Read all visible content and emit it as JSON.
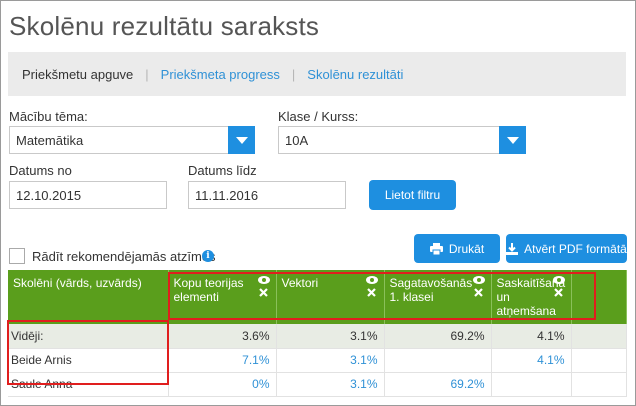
{
  "page": {
    "title": "Skolēnu rezultātu saraksts"
  },
  "subnav": {
    "items": [
      {
        "label": "Priekšmetu apguve",
        "active": true
      },
      {
        "label": "Priekšmeta progress",
        "active": false
      },
      {
        "label": "Skolēnu rezultāti",
        "active": false
      }
    ],
    "separator": "|"
  },
  "filters": {
    "subject_label": "Mācību tēma:",
    "subject_value": "Matemātika",
    "class_label": "Klase / Kurss:",
    "class_value": "10A",
    "date_from_label": "Datums no",
    "date_from_value": "12.10.2015",
    "date_to_label": "Datums līdz",
    "date_to_value": "11.11.2016",
    "apply_label": "Lietot filtru"
  },
  "options": {
    "show_recommended_label": "Rādīt rekomendējamās atzīmes",
    "info_icon": "i",
    "print_label": "Drukāt",
    "pdf_label": "Atvērt PDF formātā"
  },
  "table": {
    "headers": [
      "Skolēni (vārds, uzvārds)",
      "Kopu teorijas elementi",
      "Vektori",
      "Sagatavošanās 1. klasei",
      "Saskaitīšana un atņemšana"
    ],
    "rows": [
      {
        "name": "Vidēji:",
        "values": [
          "3.6%",
          "3.1%",
          "69.2%",
          "4.1%"
        ]
      },
      {
        "name": "Beide Arnis",
        "values": [
          "7.1%",
          "3.1%",
          "",
          "4.1%"
        ]
      },
      {
        "name": "Saule Anna",
        "values": [
          "0%",
          "3.1%",
          "69.2%",
          ""
        ]
      }
    ]
  },
  "colors": {
    "accent_blue": "#1e8fe0",
    "header_green": "#5a9e1c",
    "highlight_red": "#e01e1e"
  }
}
